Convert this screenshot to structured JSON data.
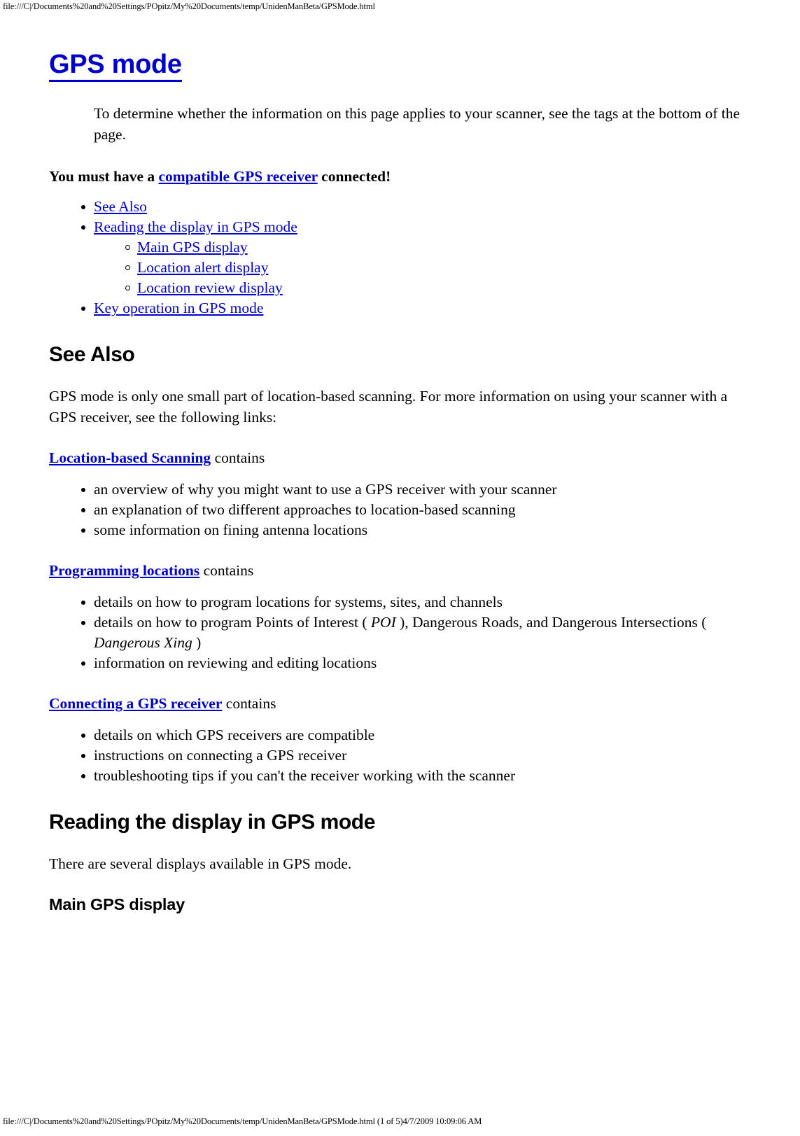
{
  "browser_chrome": {
    "header_url": "file:///C|/Documents%20and%20Settings/POpitz/My%20Documents/temp/UnidenManBeta/GPSMode.html",
    "footer_text": "file:///C|/Documents%20and%20Settings/POpitz/My%20Documents/temp/UnidenManBeta/GPSMode.html (1 of 5)4/7/2009 10:09:06 AM"
  },
  "colors": {
    "link": "#0000CC",
    "title": "#0000CC",
    "text": "#000000",
    "background": "#FFFFFF"
  },
  "document": {
    "title": "GPS mode",
    "intro_paragraph": "To determine whether the information on this page applies to your scanner, see the tags at the bottom of the page.",
    "requirement": {
      "prefix": "You must have a ",
      "link": "compatible GPS receiver",
      "suffix": " connected!"
    },
    "toc": [
      {
        "label": "See Also",
        "level": 1
      },
      {
        "label": "Reading the display in GPS mode",
        "level": 1
      },
      {
        "label": "Main GPS display",
        "level": 2
      },
      {
        "label": "Location alert display",
        "level": 2
      },
      {
        "label": "Location review display",
        "level": 2
      },
      {
        "label": "Key operation in GPS mode",
        "level": 1
      }
    ],
    "see_also": {
      "heading": "See Also",
      "intro": "GPS mode is only one small part of location-based scanning. For more information on using your scanner with a GPS receiver, see the following links:",
      "groups": [
        {
          "link": "Location-based Scanning",
          "suffix": " contains",
          "items": [
            "an overview of why you might want to use a GPS receiver with your scanner",
            "an explanation of two different approaches to location-based scanning",
            "some information on fining antenna locations"
          ]
        },
        {
          "link": "Programming locations",
          "suffix": " contains",
          "items": [
            "details on how to program locations for systems, sites, and channels",
            "details on how to program Points of Interest ( POI ), Dangerous Roads, and Dangerous Intersections ( Dangerous Xing )",
            "information on reviewing and editing locations"
          ]
        },
        {
          "link": "Connecting a GPS receiver",
          "suffix": " contains",
          "items": [
            "details on which GPS receivers are compatible",
            "instructions on connecting a GPS receiver",
            "troubleshooting tips if you can't the receiver working with the scanner"
          ]
        }
      ]
    },
    "reading_display": {
      "heading": "Reading the display in GPS mode",
      "intro": "There are several displays available in GPS mode.",
      "subheading": "Main GPS display"
    },
    "poi_segments": {
      "p1": "details on how to program Points of Interest ( ",
      "i1": "POI",
      "p2": " ), Dangerous Roads, and Dangerous Intersections ( ",
      "i2": "Dangerous Xing",
      "p3": " )"
    }
  }
}
